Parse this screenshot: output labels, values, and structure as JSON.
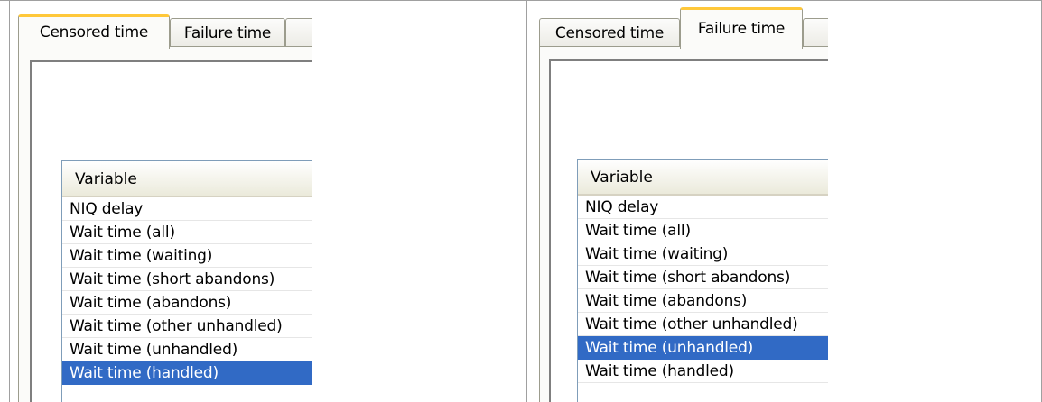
{
  "panels": [
    {
      "tabs": [
        {
          "label": "Censored time",
          "active": true
        },
        {
          "label": "Failure time",
          "active": false
        }
      ],
      "list": {
        "header": "Variable",
        "rows": [
          "NIQ delay",
          "Wait time (all)",
          "Wait time (waiting)",
          "Wait time (short abandons)",
          "Wait time (abandons)",
          "Wait time (other unhandled)",
          "Wait time (unhandled)",
          "Wait time (handled)"
        ],
        "selected_index": 7
      }
    },
    {
      "tabs": [
        {
          "label": "Censored time",
          "active": false
        },
        {
          "label": "Failure time",
          "active": true
        }
      ],
      "list": {
        "header": "Variable",
        "rows": [
          "NIQ delay",
          "Wait time (all)",
          "Wait time (waiting)",
          "Wait time (short abandons)",
          "Wait time (abandons)",
          "Wait time (other unhandled)",
          "Wait time (unhandled)",
          "Wait time (handled)"
        ],
        "selected_index": 6
      }
    }
  ],
  "colors": {
    "selection": "#316ac5",
    "active_tab_accent": "#ffc83a",
    "tab_border": "#9c9c8d"
  }
}
